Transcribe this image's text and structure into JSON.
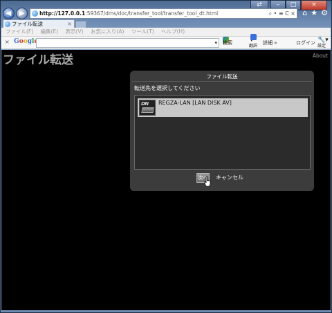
{
  "browser": {
    "url_host": "http://127.0.0.1",
    "url_rest": ":59367/dms/doc/transfer_tool/transfer_tool_dt.html",
    "url_icons": "⌕ • ≡ C ×",
    "tab_title": "ファイル転送",
    "tab_close": "×",
    "menu": [
      "ファイル(F)",
      "編集(E)",
      "表示(V)",
      "お気に入り(A)",
      "ツール(T)",
      "ヘルプ(H)"
    ],
    "toolbar": {
      "close_x": "×",
      "google_logo": [
        "G",
        "o",
        "o",
        "g",
        "l",
        "e"
      ],
      "search_dropdown": "▾",
      "search_label": "検索",
      "translate_label": "翻訳",
      "more_label": "詳細 »",
      "login_label": "ログイン",
      "settings_label": "設定"
    },
    "window_buttons": [
      "⇄",
      "–",
      "□",
      "×"
    ],
    "icons": [
      "home-icon",
      "star-icon",
      "gear-icon"
    ]
  },
  "page": {
    "title": "ファイル転送",
    "about_link": "About"
  },
  "dialog": {
    "title": "ファイル転送",
    "prompt": "転送先を選択してください",
    "devices": [
      {
        "icon_text": "DN",
        "label": "REGZA-LAN [LAN DISK AV]"
      }
    ],
    "next_button": "次へ",
    "cancel_button": "キャンセル"
  }
}
